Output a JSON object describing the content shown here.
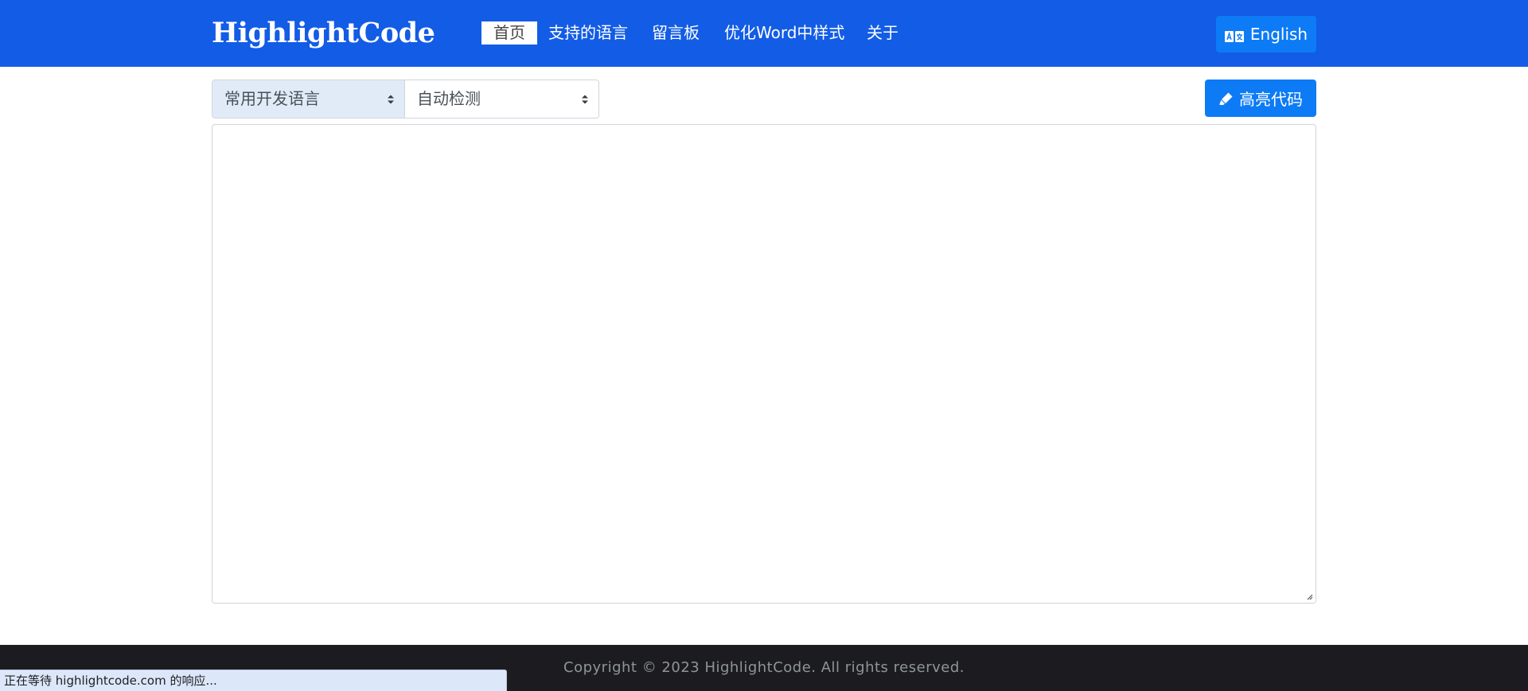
{
  "brand": "HighlightCode",
  "nav": {
    "items": [
      {
        "label": "首页",
        "active": true
      },
      {
        "label": "支持的语言"
      },
      {
        "label": "留言板"
      },
      {
        "label": "优化Word中样式"
      },
      {
        "label": "关于"
      }
    ]
  },
  "language_button": {
    "label": "English",
    "icon": "translate-icon"
  },
  "toolbar": {
    "category_select": "常用开发语言",
    "language_select": "自动检测",
    "highlight_button": "高亮代码",
    "highlight_icon": "pen-icon"
  },
  "editor": {
    "value": ""
  },
  "footer": {
    "copyright": "Copyright © 2023 HighlightCode. All rights reserved."
  },
  "status_bar": {
    "text": "正在等待 highlightcode.com 的响应..."
  },
  "colors": {
    "navbar": "#135ce5",
    "primary_button": "#0d7bf5",
    "footer": "#1c1c20"
  }
}
